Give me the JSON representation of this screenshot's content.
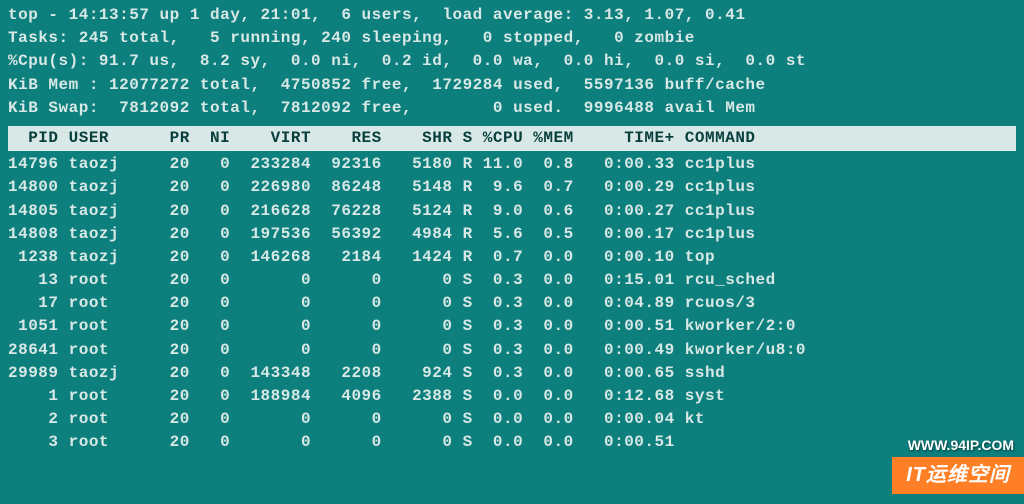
{
  "summary": {
    "line1": "top - 14:13:57 up 1 day, 21:01,  6 users,  load average: 3.13, 1.07, 0.41",
    "line2": "Tasks: 245 total,   5 running, 240 sleeping,   0 stopped,   0 zombie",
    "line3": "%Cpu(s): 91.7 us,  8.2 sy,  0.0 ni,  0.2 id,  0.0 wa,  0.0 hi,  0.0 si,  0.0 st",
    "line4": "KiB Mem : 12077272 total,  4750852 free,  1729284 used,  5597136 buff/cache",
    "line5": "KiB Swap:  7812092 total,  7812092 free,        0 used.  9996488 avail Mem "
  },
  "columns": [
    "PID",
    "USER",
    "PR",
    "NI",
    "VIRT",
    "RES",
    "SHR",
    "S",
    "%CPU",
    "%MEM",
    "TIME+",
    "COMMAND"
  ],
  "header_text": "  PID USER      PR  NI    VIRT    RES    SHR S %CPU %MEM     TIME+ COMMAND   ",
  "processes": [
    {
      "pid": "14796",
      "user": "taozj",
      "pr": "20",
      "ni": "0",
      "virt": "233284",
      "res": "92316",
      "shr": "5180",
      "s": "R",
      "cpu": "11.0",
      "mem": "0.8",
      "time": "0:00.33",
      "cmd": "cc1plus"
    },
    {
      "pid": "14800",
      "user": "taozj",
      "pr": "20",
      "ni": "0",
      "virt": "226980",
      "res": "86248",
      "shr": "5148",
      "s": "R",
      "cpu": "9.6",
      "mem": "0.7",
      "time": "0:00.29",
      "cmd": "cc1plus"
    },
    {
      "pid": "14805",
      "user": "taozj",
      "pr": "20",
      "ni": "0",
      "virt": "216628",
      "res": "76228",
      "shr": "5124",
      "s": "R",
      "cpu": "9.0",
      "mem": "0.6",
      "time": "0:00.27",
      "cmd": "cc1plus"
    },
    {
      "pid": "14808",
      "user": "taozj",
      "pr": "20",
      "ni": "0",
      "virt": "197536",
      "res": "56392",
      "shr": "4984",
      "s": "R",
      "cpu": "5.6",
      "mem": "0.5",
      "time": "0:00.17",
      "cmd": "cc1plus"
    },
    {
      "pid": "1238",
      "user": "taozj",
      "pr": "20",
      "ni": "0",
      "virt": "146268",
      "res": "2184",
      "shr": "1424",
      "s": "R",
      "cpu": "0.7",
      "mem": "0.0",
      "time": "0:00.10",
      "cmd": "top"
    },
    {
      "pid": "13",
      "user": "root",
      "pr": "20",
      "ni": "0",
      "virt": "0",
      "res": "0",
      "shr": "0",
      "s": "S",
      "cpu": "0.3",
      "mem": "0.0",
      "time": "0:15.01",
      "cmd": "rcu_sched"
    },
    {
      "pid": "17",
      "user": "root",
      "pr": "20",
      "ni": "0",
      "virt": "0",
      "res": "0",
      "shr": "0",
      "s": "S",
      "cpu": "0.3",
      "mem": "0.0",
      "time": "0:04.89",
      "cmd": "rcuos/3"
    },
    {
      "pid": "1051",
      "user": "root",
      "pr": "20",
      "ni": "0",
      "virt": "0",
      "res": "0",
      "shr": "0",
      "s": "S",
      "cpu": "0.3",
      "mem": "0.0",
      "time": "0:00.51",
      "cmd": "kworker/2:0"
    },
    {
      "pid": "28641",
      "user": "root",
      "pr": "20",
      "ni": "0",
      "virt": "0",
      "res": "0",
      "shr": "0",
      "s": "S",
      "cpu": "0.3",
      "mem": "0.0",
      "time": "0:00.49",
      "cmd": "kworker/u8:0"
    },
    {
      "pid": "29989",
      "user": "taozj",
      "pr": "20",
      "ni": "0",
      "virt": "143348",
      "res": "2208",
      "shr": "924",
      "s": "S",
      "cpu": "0.3",
      "mem": "0.0",
      "time": "0:00.65",
      "cmd": "sshd"
    },
    {
      "pid": "1",
      "user": "root",
      "pr": "20",
      "ni": "0",
      "virt": "188984",
      "res": "4096",
      "shr": "2388",
      "s": "S",
      "cpu": "0.0",
      "mem": "0.0",
      "time": "0:12.68",
      "cmd": "syst"
    },
    {
      "pid": "2",
      "user": "root",
      "pr": "20",
      "ni": "0",
      "virt": "0",
      "res": "0",
      "shr": "0",
      "s": "S",
      "cpu": "0.0",
      "mem": "0.0",
      "time": "0:00.04",
      "cmd": "kt"
    },
    {
      "pid": "3",
      "user": "root",
      "pr": "20",
      "ni": "0",
      "virt": "0",
      "res": "0",
      "shr": "0",
      "s": "S",
      "cpu": "0.0",
      "mem": "0.0",
      "time": "0:00.51",
      "cmd": ""
    }
  ],
  "watermark": {
    "url": "WWW.94IP.COM",
    "label": "IT运维空间"
  }
}
